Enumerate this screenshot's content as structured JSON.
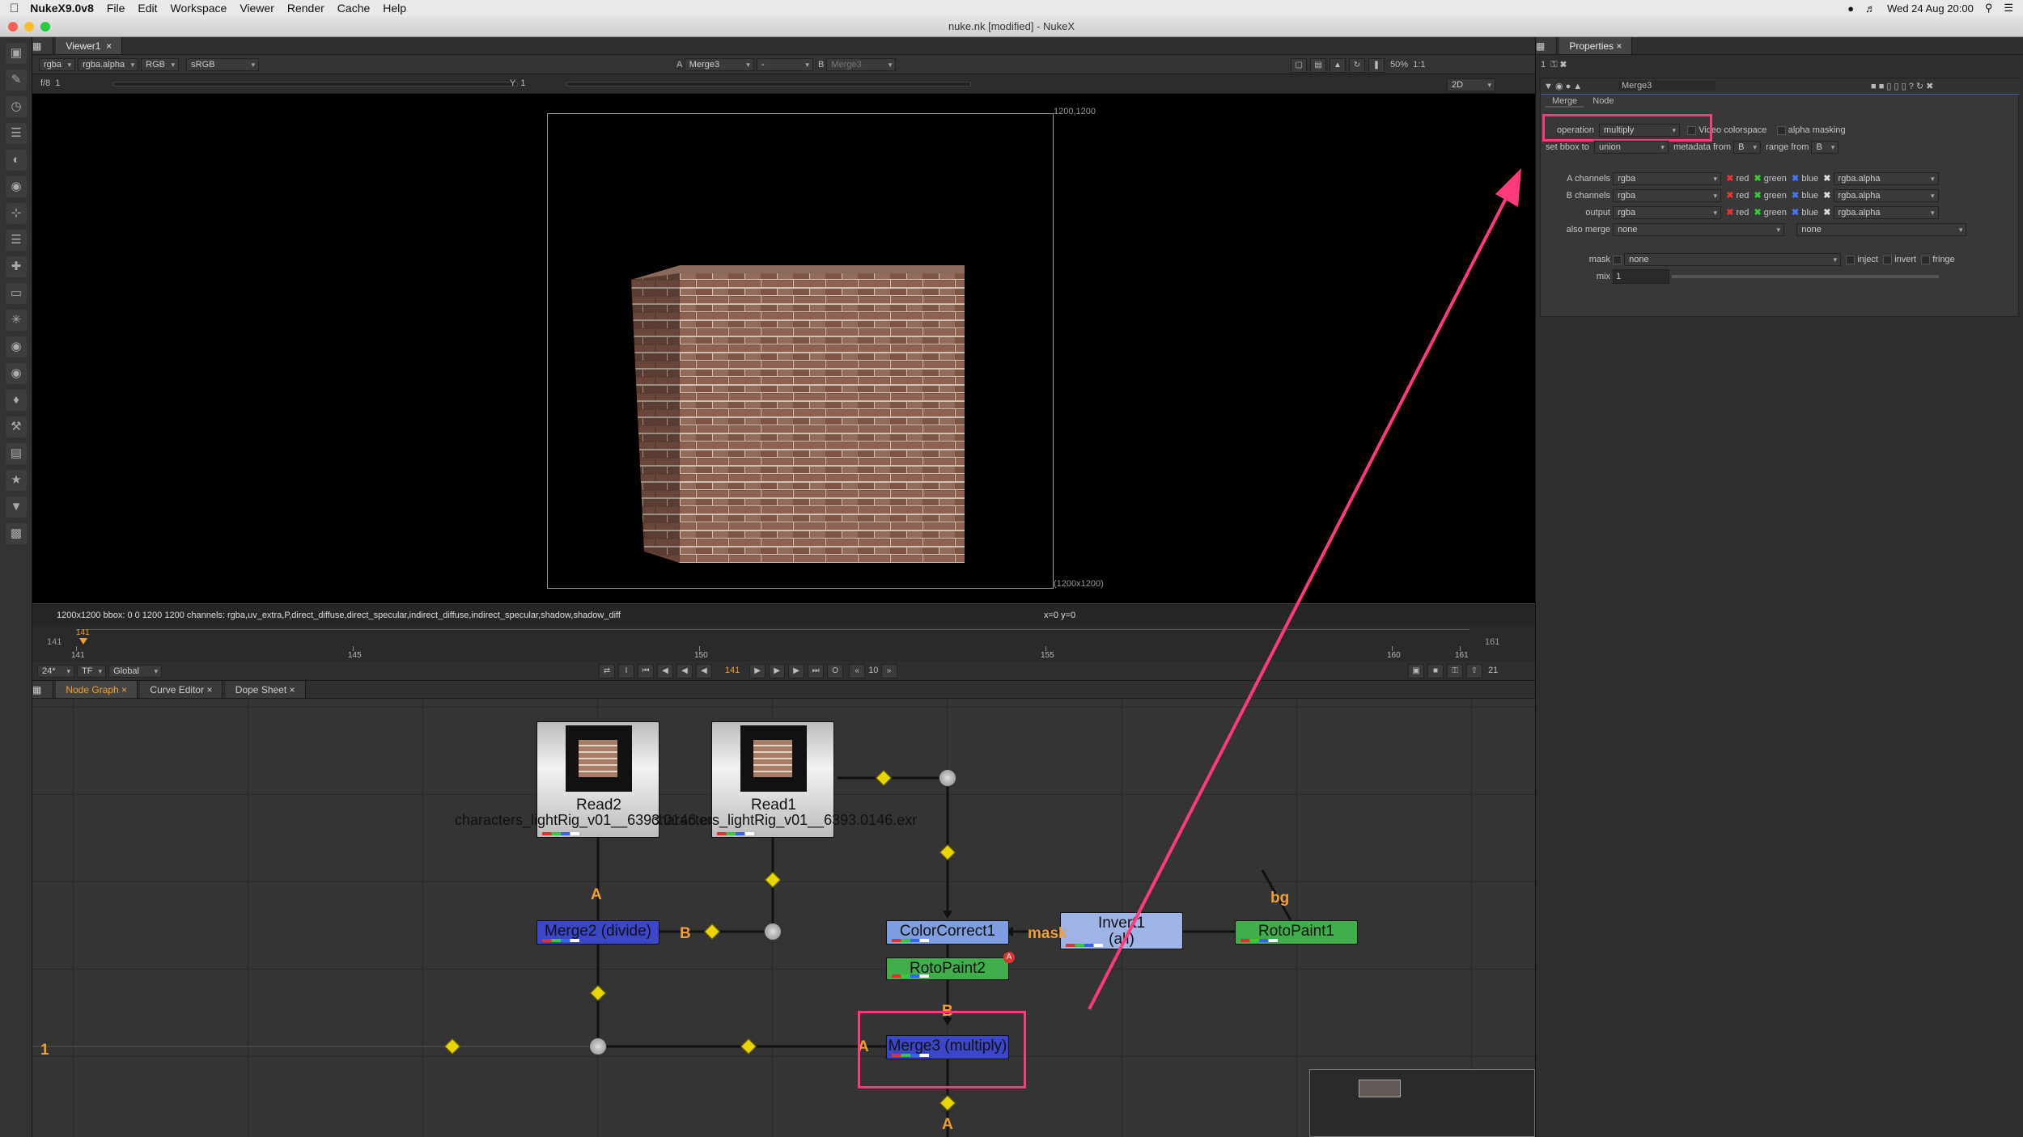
{
  "menubar": {
    "app": "NukeX9.0v8",
    "items": [
      "File",
      "Edit",
      "Workspace",
      "Viewer",
      "Render",
      "Cache",
      "Help"
    ],
    "clock": "Wed 24 Aug  20:00"
  },
  "window": {
    "title": "nuke.nk [modified] - NukeX"
  },
  "viewer": {
    "tab": "Viewer1",
    "channels": "rgba",
    "alpha": "rgba.alpha",
    "colorspace_mode": "RGB",
    "lut": "sRGB",
    "input_a_label": "A",
    "input_a": "Merge3",
    "input_b_label": "B",
    "input_b": "Merge3",
    "wipe": "-",
    "fstop": "f/8",
    "gain": "1",
    "y_label": "Y",
    "gamma": "1",
    "zoom": "50%",
    "ratio": "1:1",
    "mode": "2D",
    "format_tr": "1200,1200",
    "format_br": "(1200x1200)",
    "status": "1200x1200  bbox: 0 0 1200 1200 channels: rgba,uv_extra,P,direct_diffuse,direct_specular,indirect_diffuse,indirect_specular,shadow,shadow_diff",
    "coords": "x=0 y=0"
  },
  "timeline": {
    "start": "141",
    "end": "161",
    "current": "141",
    "ticks": [
      "141",
      "145",
      "150",
      "155",
      "160",
      "161"
    ],
    "fps": "24*",
    "tf": "TF",
    "scope": "Global",
    "step": "10",
    "frame_field": "141",
    "end_field": "21"
  },
  "graph_tabs": [
    "Node Graph",
    "Curve Editor",
    "Dope Sheet"
  ],
  "nodes": {
    "read2": {
      "name": "Read2",
      "file": "characters_lightRig_v01__6393.0146.exr"
    },
    "read1": {
      "name": "Read1",
      "file": "characters_lightRig_v01__6393.0146.exr"
    },
    "merge2": "Merge2 (divide)",
    "colorcorrect": "ColorCorrect1",
    "invert": "Invert1",
    "invert_sub": "(all)",
    "rotopaint1": "RotoPaint1",
    "rotopaint2": "RotoPaint2",
    "merge3": "Merge3 (multiply)",
    "lbl_a1": "A",
    "lbl_b1": "B",
    "lbl_mask": "mask",
    "lbl_bg": "bg",
    "lbl_b2": "B",
    "lbl_a2": "A",
    "lbl_a3": "A",
    "lbl_1": "1",
    "roto_badge": "A"
  },
  "properties": {
    "tab": "Properties",
    "node_name": "Merge3",
    "max_panels": "1",
    "subtabs": [
      "Merge",
      "Node"
    ],
    "operation_label": "operation",
    "operation": "multiply",
    "video_colorspace": "Video colorspace",
    "alpha_masking": "alpha masking",
    "bbox_label": "set bbox to",
    "bbox": "union",
    "metadata_label": "metadata from",
    "metadata": "B",
    "range_label": "range from",
    "range": "B",
    "rows": [
      {
        "label": "A channels",
        "value": "rgba",
        "alpha": "rgba.alpha"
      },
      {
        "label": "B channels",
        "value": "rgba",
        "alpha": "rgba.alpha"
      },
      {
        "label": "output",
        "value": "rgba",
        "alpha": "rgba.alpha"
      }
    ],
    "chan_red": "red",
    "chan_green": "green",
    "chan_blue": "blue",
    "also_merge_label": "also merge",
    "also_merge": "none",
    "also_merge2": "none",
    "mask_label": "mask",
    "mask": "none",
    "inject": "inject",
    "invert": "invert",
    "fringe": "fringe",
    "mix_label": "mix",
    "mix": "1"
  },
  "colors": {
    "accent": "#f0a030",
    "annotation": "#ff3a7a",
    "merge_node": "#3b47c8",
    "roto_node": "#3fae4b",
    "cc_node": "#7f9ee0"
  }
}
